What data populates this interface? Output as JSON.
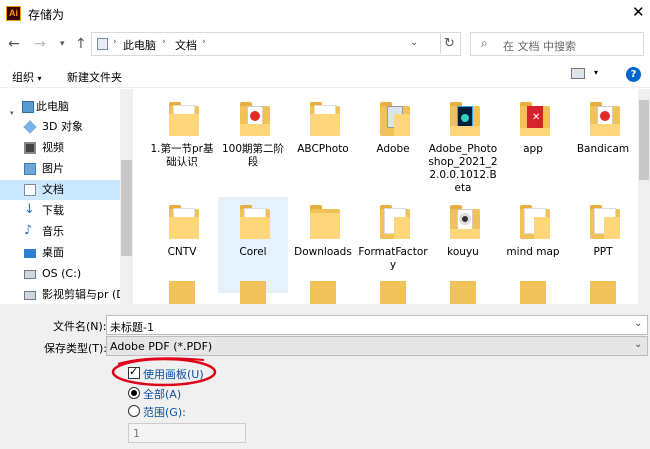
{
  "window": {
    "title": "存储为",
    "app_icon_text": "Ai"
  },
  "address": {
    "segments": [
      "此电脑",
      "文档"
    ]
  },
  "search": {
    "placeholder": "在 文档 中搜索"
  },
  "toolbar": {
    "organize": "组织",
    "new_folder": "新建文件夹",
    "help": "?"
  },
  "nav": {
    "items": [
      {
        "label": "此电脑",
        "icon": "computer-icon"
      },
      {
        "label": "3D 对象",
        "icon": "cube-icon"
      },
      {
        "label": "视频",
        "icon": "video-icon"
      },
      {
        "label": "图片",
        "icon": "pictures-icon"
      },
      {
        "label": "文档",
        "icon": "documents-icon",
        "selected": true
      },
      {
        "label": "下载",
        "icon": "download-icon"
      },
      {
        "label": "音乐",
        "icon": "music-icon"
      },
      {
        "label": "桌面",
        "icon": "desktop-icon"
      },
      {
        "label": "OS (C:)",
        "icon": "drive-icon"
      },
      {
        "label": "影视剪辑与pr (D",
        "icon": "drive-icon"
      }
    ]
  },
  "files": [
    {
      "label": "1.第一节pr基础认识",
      "kind": "folder"
    },
    {
      "label": "100期第二阶段",
      "kind": "red-media"
    },
    {
      "label": "ABCPhoto",
      "kind": "folder"
    },
    {
      "label": "Adobe",
      "kind": "folder-doc"
    },
    {
      "label": "Adobe_Photoshop_2021_22.0.0.1012.Beta",
      "kind": "ps"
    },
    {
      "label": "app",
      "kind": "red-app"
    },
    {
      "label": "Bandicam",
      "kind": "red-media"
    },
    {
      "label": "CNTV",
      "kind": "folder"
    },
    {
      "label": "Corel",
      "kind": "folder",
      "selected": true
    },
    {
      "label": "Downloads",
      "kind": "folder"
    },
    {
      "label": "FormatFactory",
      "kind": "folder-doc"
    },
    {
      "label": "kouyu",
      "kind": "disc"
    },
    {
      "label": "mind map",
      "kind": "folder-doc"
    },
    {
      "label": "PPT",
      "kind": "folder-doc"
    }
  ],
  "form": {
    "filename_label": "文件名(N):",
    "filename_value": "未标题-1",
    "filetype_label": "保存类型(T):",
    "filetype_value": "Adobe PDF (*.PDF)",
    "use_artboards": "使用画板(U)",
    "all": "全部(A)",
    "range": "范围(G):",
    "range_value": "1"
  },
  "colors": {
    "accent": "#0078d7",
    "annotation": "#e0001b",
    "folder": "#f2c25a"
  }
}
